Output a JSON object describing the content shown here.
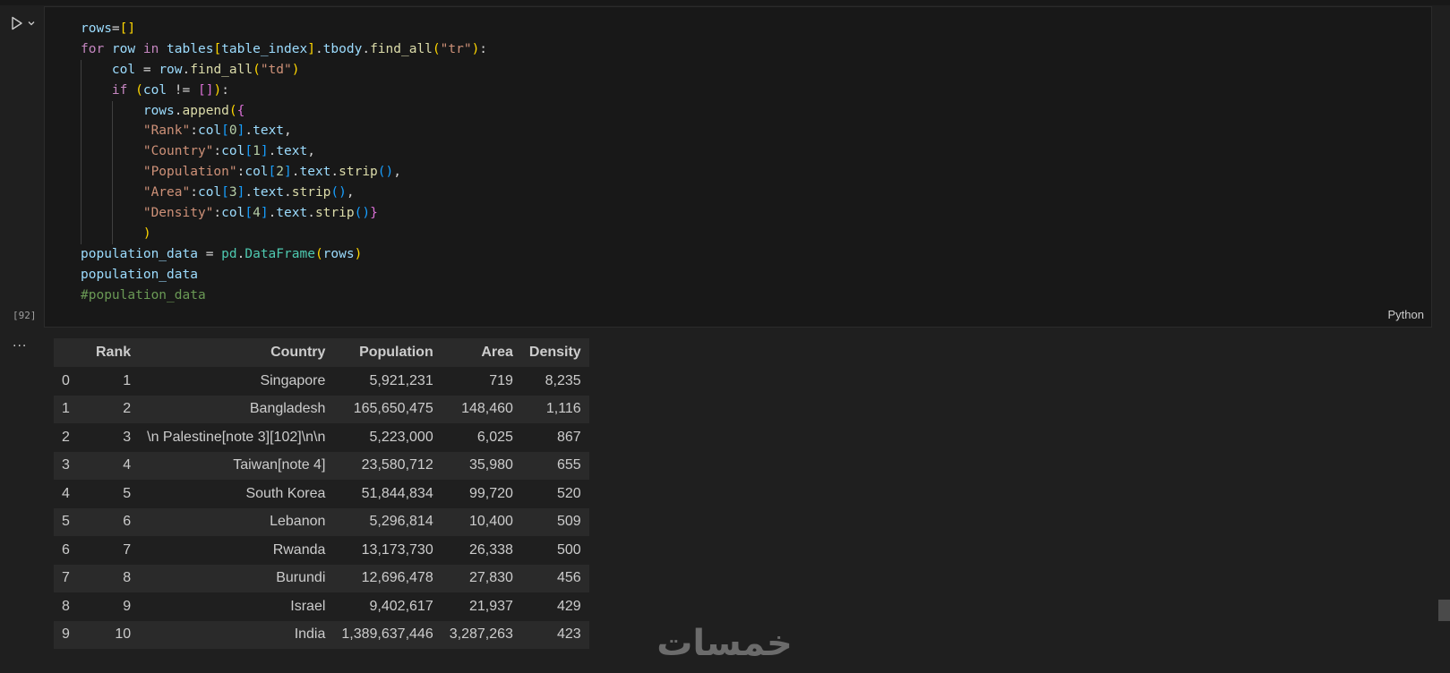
{
  "cell": {
    "exec_count": "[92]",
    "language": "Python",
    "code_lines": [
      [
        {
          "t": "rows",
          "c": "tk-var"
        },
        {
          "t": "=",
          "c": "tk-op"
        },
        {
          "t": "[]",
          "c": "tk-bracket1"
        }
      ],
      [
        {
          "t": "for ",
          "c": "tk-kw"
        },
        {
          "t": "row ",
          "c": "tk-var"
        },
        {
          "t": "in ",
          "c": "tk-kw"
        },
        {
          "t": "tables",
          "c": "tk-var"
        },
        {
          "t": "[",
          "c": "tk-bracket1"
        },
        {
          "t": "table_index",
          "c": "tk-var"
        },
        {
          "t": "]",
          "c": "tk-bracket1"
        },
        {
          "t": ".",
          "c": "tk-op"
        },
        {
          "t": "tbody",
          "c": "tk-var"
        },
        {
          "t": ".",
          "c": "tk-op"
        },
        {
          "t": "find_all",
          "c": "tk-fn"
        },
        {
          "t": "(",
          "c": "tk-bracket1"
        },
        {
          "t": "\"tr\"",
          "c": "tk-str"
        },
        {
          "t": ")",
          "c": "tk-bracket1"
        },
        {
          "t": ":",
          "c": "tk-op"
        }
      ],
      [
        {
          "t": "    ",
          "c": "tk-plain"
        },
        {
          "t": "col ",
          "c": "tk-var"
        },
        {
          "t": "= ",
          "c": "tk-op"
        },
        {
          "t": "row",
          "c": "tk-var"
        },
        {
          "t": ".",
          "c": "tk-op"
        },
        {
          "t": "find_all",
          "c": "tk-fn"
        },
        {
          "t": "(",
          "c": "tk-bracket1"
        },
        {
          "t": "\"td\"",
          "c": "tk-str"
        },
        {
          "t": ")",
          "c": "tk-bracket1"
        }
      ],
      [
        {
          "t": "    ",
          "c": "tk-plain"
        },
        {
          "t": "if ",
          "c": "tk-kw"
        },
        {
          "t": "(",
          "c": "tk-bracket1"
        },
        {
          "t": "col ",
          "c": "tk-var"
        },
        {
          "t": "!= ",
          "c": "tk-op"
        },
        {
          "t": "[]",
          "c": "tk-bracket2"
        },
        {
          "t": ")",
          "c": "tk-bracket1"
        },
        {
          "t": ":",
          "c": "tk-op"
        }
      ],
      [
        {
          "t": "        ",
          "c": "tk-plain"
        },
        {
          "t": "rows",
          "c": "tk-var"
        },
        {
          "t": ".",
          "c": "tk-op"
        },
        {
          "t": "append",
          "c": "tk-fn"
        },
        {
          "t": "(",
          "c": "tk-bracket1"
        },
        {
          "t": "{",
          "c": "tk-bracket2"
        }
      ],
      [
        {
          "t": "        ",
          "c": "tk-plain"
        },
        {
          "t": "\"Rank\"",
          "c": "tk-str"
        },
        {
          "t": ":",
          "c": "tk-op"
        },
        {
          "t": "col",
          "c": "tk-var"
        },
        {
          "t": "[",
          "c": "tk-bracket3"
        },
        {
          "t": "0",
          "c": "tk-num"
        },
        {
          "t": "]",
          "c": "tk-bracket3"
        },
        {
          "t": ".",
          "c": "tk-op"
        },
        {
          "t": "text",
          "c": "tk-var"
        },
        {
          "t": ",",
          "c": "tk-op"
        }
      ],
      [
        {
          "t": "        ",
          "c": "tk-plain"
        },
        {
          "t": "\"Country\"",
          "c": "tk-str"
        },
        {
          "t": ":",
          "c": "tk-op"
        },
        {
          "t": "col",
          "c": "tk-var"
        },
        {
          "t": "[",
          "c": "tk-bracket3"
        },
        {
          "t": "1",
          "c": "tk-num"
        },
        {
          "t": "]",
          "c": "tk-bracket3"
        },
        {
          "t": ".",
          "c": "tk-op"
        },
        {
          "t": "text",
          "c": "tk-var"
        },
        {
          "t": ",",
          "c": "tk-op"
        }
      ],
      [
        {
          "t": "        ",
          "c": "tk-plain"
        },
        {
          "t": "\"Population\"",
          "c": "tk-str"
        },
        {
          "t": ":",
          "c": "tk-op"
        },
        {
          "t": "col",
          "c": "tk-var"
        },
        {
          "t": "[",
          "c": "tk-bracket3"
        },
        {
          "t": "2",
          "c": "tk-num"
        },
        {
          "t": "]",
          "c": "tk-bracket3"
        },
        {
          "t": ".",
          "c": "tk-op"
        },
        {
          "t": "text",
          "c": "tk-var"
        },
        {
          "t": ".",
          "c": "tk-op"
        },
        {
          "t": "strip",
          "c": "tk-fn"
        },
        {
          "t": "()",
          "c": "tk-bracket3"
        },
        {
          "t": ",",
          "c": "tk-op"
        }
      ],
      [
        {
          "t": "        ",
          "c": "tk-plain"
        },
        {
          "t": "\"Area\"",
          "c": "tk-str"
        },
        {
          "t": ":",
          "c": "tk-op"
        },
        {
          "t": "col",
          "c": "tk-var"
        },
        {
          "t": "[",
          "c": "tk-bracket3"
        },
        {
          "t": "3",
          "c": "tk-num"
        },
        {
          "t": "]",
          "c": "tk-bracket3"
        },
        {
          "t": ".",
          "c": "tk-op"
        },
        {
          "t": "text",
          "c": "tk-var"
        },
        {
          "t": ".",
          "c": "tk-op"
        },
        {
          "t": "strip",
          "c": "tk-fn"
        },
        {
          "t": "()",
          "c": "tk-bracket3"
        },
        {
          "t": ",",
          "c": "tk-op"
        }
      ],
      [
        {
          "t": "        ",
          "c": "tk-plain"
        },
        {
          "t": "\"Density\"",
          "c": "tk-str"
        },
        {
          "t": ":",
          "c": "tk-op"
        },
        {
          "t": "col",
          "c": "tk-var"
        },
        {
          "t": "[",
          "c": "tk-bracket3"
        },
        {
          "t": "4",
          "c": "tk-num"
        },
        {
          "t": "]",
          "c": "tk-bracket3"
        },
        {
          "t": ".",
          "c": "tk-op"
        },
        {
          "t": "text",
          "c": "tk-var"
        },
        {
          "t": ".",
          "c": "tk-op"
        },
        {
          "t": "strip",
          "c": "tk-fn"
        },
        {
          "t": "()",
          "c": "tk-bracket3"
        },
        {
          "t": "}",
          "c": "tk-bracket2"
        }
      ],
      [
        {
          "t": "        ",
          "c": "tk-plain"
        },
        {
          "t": ")",
          "c": "tk-bracket1"
        }
      ],
      [
        {
          "t": "population_data ",
          "c": "tk-var"
        },
        {
          "t": "= ",
          "c": "tk-op"
        },
        {
          "t": "pd",
          "c": "tk-cls"
        },
        {
          "t": ".",
          "c": "tk-op"
        },
        {
          "t": "DataFrame",
          "c": "tk-cls"
        },
        {
          "t": "(",
          "c": "tk-bracket1"
        },
        {
          "t": "rows",
          "c": "tk-var"
        },
        {
          "t": ")",
          "c": "tk-bracket1"
        }
      ],
      [
        {
          "t": "population_data",
          "c": "tk-var"
        }
      ],
      [
        {
          "t": "#population_data",
          "c": "tk-comment"
        }
      ]
    ]
  },
  "output": {
    "menu_label": "...",
    "columns": [
      "",
      "Rank",
      "Country",
      "Population",
      "Area",
      "Density"
    ],
    "rows": [
      [
        "0",
        "1",
        "Singapore",
        "5,921,231",
        "719",
        "8,235"
      ],
      [
        "1",
        "2",
        "Bangladesh",
        "165,650,475",
        "148,460",
        "1,116"
      ],
      [
        "2",
        "3",
        "\\n Palestine[note 3][102]\\n\\n",
        "5,223,000",
        "6,025",
        "867"
      ],
      [
        "3",
        "4",
        "Taiwan[note 4]",
        "23,580,712",
        "35,980",
        "655"
      ],
      [
        "4",
        "5",
        "South Korea",
        "51,844,834",
        "99,720",
        "520"
      ],
      [
        "5",
        "6",
        "Lebanon",
        "5,296,814",
        "10,400",
        "509"
      ],
      [
        "6",
        "7",
        "Rwanda",
        "13,173,730",
        "26,338",
        "500"
      ],
      [
        "7",
        "8",
        "Burundi",
        "12,696,478",
        "27,830",
        "456"
      ],
      [
        "8",
        "9",
        "Israel",
        "9,402,617",
        "21,937",
        "429"
      ],
      [
        "9",
        "10",
        "India",
        "1,389,637,446",
        "3,287,263",
        "423"
      ]
    ]
  },
  "watermark": {
    "text": "خمسات",
    "color": "#6b6b6b"
  },
  "icons": {
    "run": "play-icon",
    "chevron": "chevron-down-icon"
  }
}
